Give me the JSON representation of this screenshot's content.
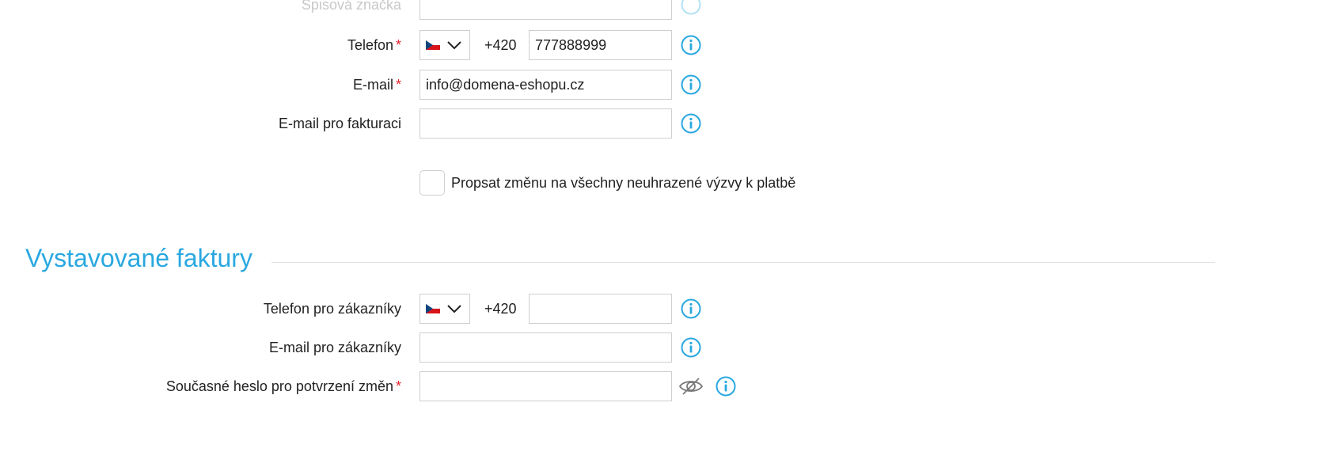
{
  "top_partial": {
    "label": "Spisová značka"
  },
  "contact": {
    "phone": {
      "label": "Telefon",
      "required_mark": "*",
      "country_flag": "cz-flag",
      "prefix": "+420",
      "value": "777888999"
    },
    "email": {
      "label": "E-mail",
      "required_mark": "*",
      "value": "info@domena-eshopu.cz"
    },
    "billing_email": {
      "label": "E-mail pro fakturaci",
      "value": ""
    },
    "propagate_checkbox": {
      "label": "Propsat změnu na všechny neuhrazené výzvy k platbě",
      "checked": false
    }
  },
  "invoices_section": {
    "title": "Vystavované faktury",
    "customer_phone": {
      "label": "Telefon pro zákazníky",
      "country_flag": "cz-flag",
      "prefix": "+420",
      "value": ""
    },
    "customer_email": {
      "label": "E-mail pro zákazníky",
      "value": ""
    },
    "current_password": {
      "label": "Současné heslo pro potvrzení změn",
      "required_mark": "*",
      "value": "",
      "toggle_icon": "eye-slash-icon"
    }
  },
  "colors": {
    "accent": "#29a8e0",
    "required": "#e3262f",
    "border": "#cfcfcf"
  },
  "icons": {
    "info": "info-circle-icon",
    "dropdown": "chevron-down-icon"
  }
}
